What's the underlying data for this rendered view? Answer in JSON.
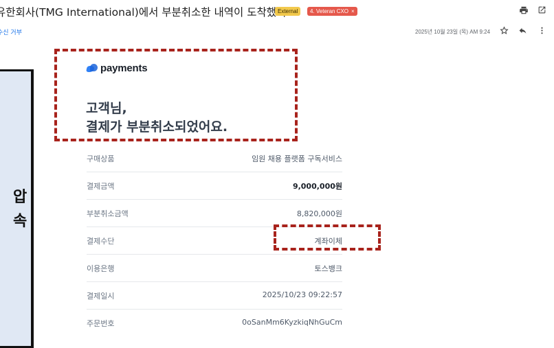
{
  "email": {
    "subject": "유한회사(TMG International)에서 부분취소한 내역이 도착했어요.",
    "labels": [
      {
        "text": "External",
        "color": "#f2c94c"
      },
      {
        "text": "4. Veteran CXO",
        "color": "#e5584b",
        "close": "×"
      }
    ],
    "unsubscribe": "수신 거부",
    "date": "2025년 10월 23일 (목) AM 9:24",
    "icons": [
      "print-icon",
      "open-new-window-icon",
      "star-icon",
      "reply-icon",
      "more-vert-icon"
    ]
  },
  "left_panel": {
    "chars": [
      "압",
      "속"
    ]
  },
  "receipt": {
    "brand": "payments",
    "brand_color": "#3182f6",
    "greeting": "고객님,",
    "message": "결제가 부분취소되었어요.",
    "rows": [
      {
        "label": "구매상품",
        "value": "임원 채용 플랫폼 구독서비스"
      },
      {
        "label": "결제금액",
        "value": "9,000,000원"
      },
      {
        "label": "부분취소금액",
        "value": "8,820,000원"
      },
      {
        "label": "결제수단",
        "value": "계좌이체"
      },
      {
        "label": "이용은행",
        "value": "토스뱅크"
      },
      {
        "label": "결제일시",
        "value": "2025/10/23 09:22:57"
      },
      {
        "label": "주문번호",
        "value": "0oSanMm6KyzkiqNhGuCm"
      }
    ],
    "highlight_color": "#a8231c"
  }
}
